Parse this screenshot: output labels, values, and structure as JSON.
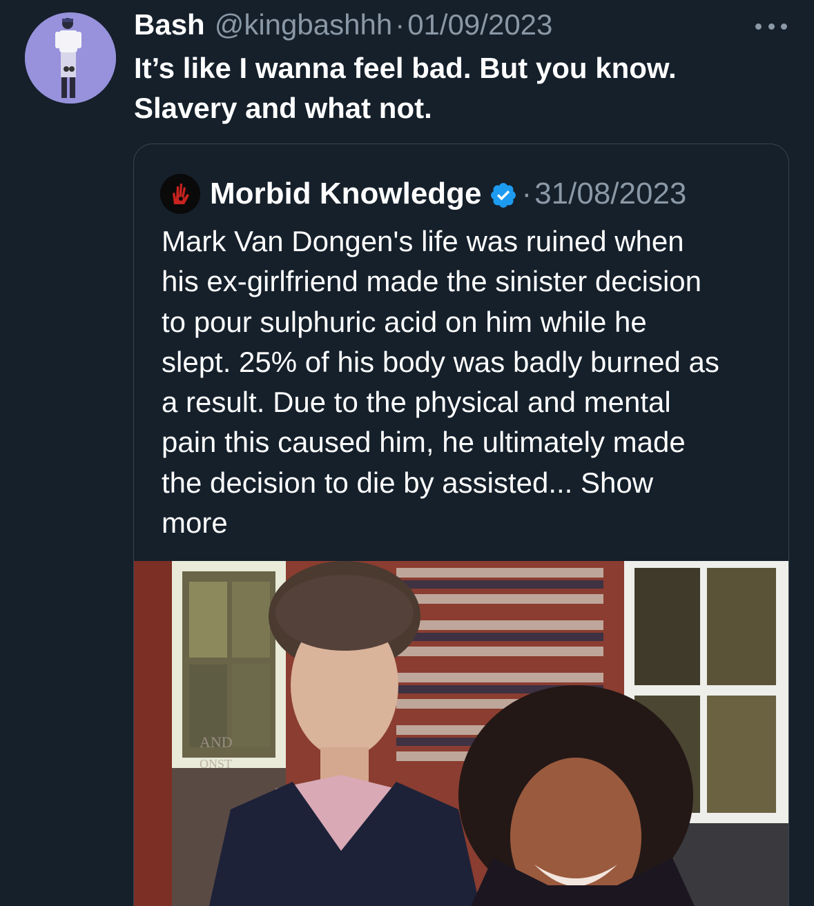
{
  "tweet": {
    "display_name": "Bash",
    "handle": "@kingbashhh",
    "separator": "·",
    "date": "01/09/2023",
    "text_line1": "It’s like I wanna feel bad. But you know.",
    "text_line2": "Slavery and what not.",
    "more_icon": "more-horizontal-icon"
  },
  "quote": {
    "display_name": "Morbid Knowledge",
    "verified_icon": "verified-badge-icon",
    "separator": "·",
    "date": "31/08/2023",
    "text": "Mark Van Dongen's life was ruined when\nhis ex-girlfriend made the sinister decision\nto pour sulphuric acid on him while he\nslept. 25% of his body was badly burned as\na result. Due to the physical and mental\npain this caused him,  he ultimately made\nthe decision to die by assisted...",
    "show_more": "Show\nmore",
    "image_text": [
      "AND",
      "ONST"
    ]
  },
  "colors": {
    "background": "#15202b",
    "secondary_text": "#8b98a5",
    "border": "#38444d",
    "verified": "#1d9bf0"
  }
}
